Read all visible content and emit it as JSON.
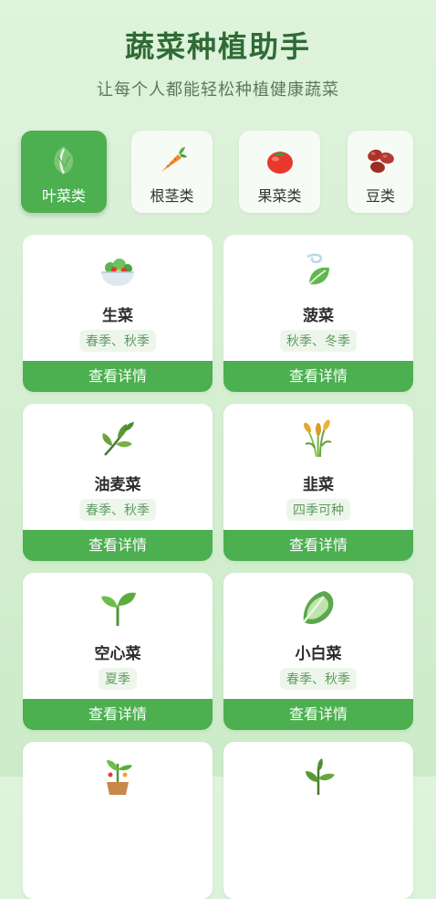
{
  "header": {
    "title": "蔬菜种植助手",
    "subtitle": "让每个人都能轻松种植健康蔬菜"
  },
  "tabs": [
    {
      "label": "叶菜类",
      "icon": "leafy-vegetable-icon",
      "active": true
    },
    {
      "label": "根茎类",
      "icon": "carrot-icon",
      "active": false
    },
    {
      "label": "果菜类",
      "icon": "tomato-icon",
      "active": false
    },
    {
      "label": "豆类",
      "icon": "beans-icon",
      "active": false
    }
  ],
  "cards": [
    {
      "name": "生菜",
      "season": "春季、秋季",
      "button": "查看详情",
      "icon": "salad-bowl-icon"
    },
    {
      "name": "菠菜",
      "season": "秋季、冬季",
      "button": "查看详情",
      "icon": "leaf-wind-icon"
    },
    {
      "name": "油麦菜",
      "season": "春季、秋季",
      "button": "查看详情",
      "icon": "herb-icon"
    },
    {
      "name": "韭菜",
      "season": "四季可种",
      "button": "查看详情",
      "icon": "sheaf-icon"
    },
    {
      "name": "空心菜",
      "season": "夏季",
      "button": "查看详情",
      "icon": "seedling-icon"
    },
    {
      "name": "小白菜",
      "season": "春季、秋季",
      "button": "查看详情",
      "icon": "leafy-green-icon"
    },
    {
      "name": "",
      "season": "",
      "button": "",
      "icon": "potted-plant-icon"
    },
    {
      "name": "",
      "season": "",
      "button": "",
      "icon": "herb-icon"
    }
  ],
  "colors": {
    "accent": "#4caf50",
    "title": "#2f6b35",
    "background": "#d6efd3"
  }
}
